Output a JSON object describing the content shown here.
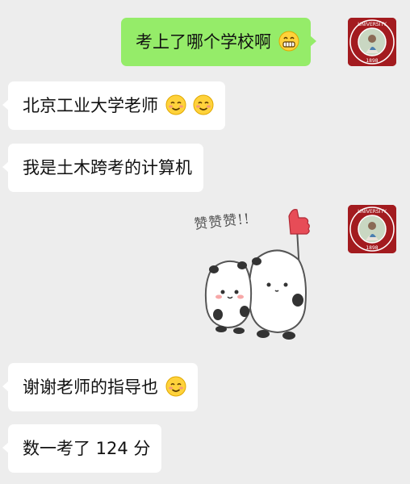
{
  "messages": [
    {
      "side": "out",
      "text": "考上了哪个学校啊",
      "emoji": "grin-emoji"
    },
    {
      "side": "in",
      "text": "北京工业大学老师",
      "emoji": "smile-emoji x2"
    },
    {
      "side": "in",
      "text": "我是土木跨考的计算机"
    },
    {
      "side": "out",
      "type": "sticker",
      "caption": "赞赞赞!!"
    },
    {
      "side": "in",
      "text": "谢谢老师的指导也",
      "emoji": "smile-emoji"
    },
    {
      "side": "in",
      "text": "数一考了 124 分"
    }
  ],
  "avatar": {
    "seal_text": "PEKING UNIVERSITY",
    "seal_year": "1898"
  },
  "colors": {
    "background": "#ededed",
    "incoming_bubble": "#ffffff",
    "outgoing_bubble": "#95ec69",
    "seal_red": "#a31b1f"
  }
}
